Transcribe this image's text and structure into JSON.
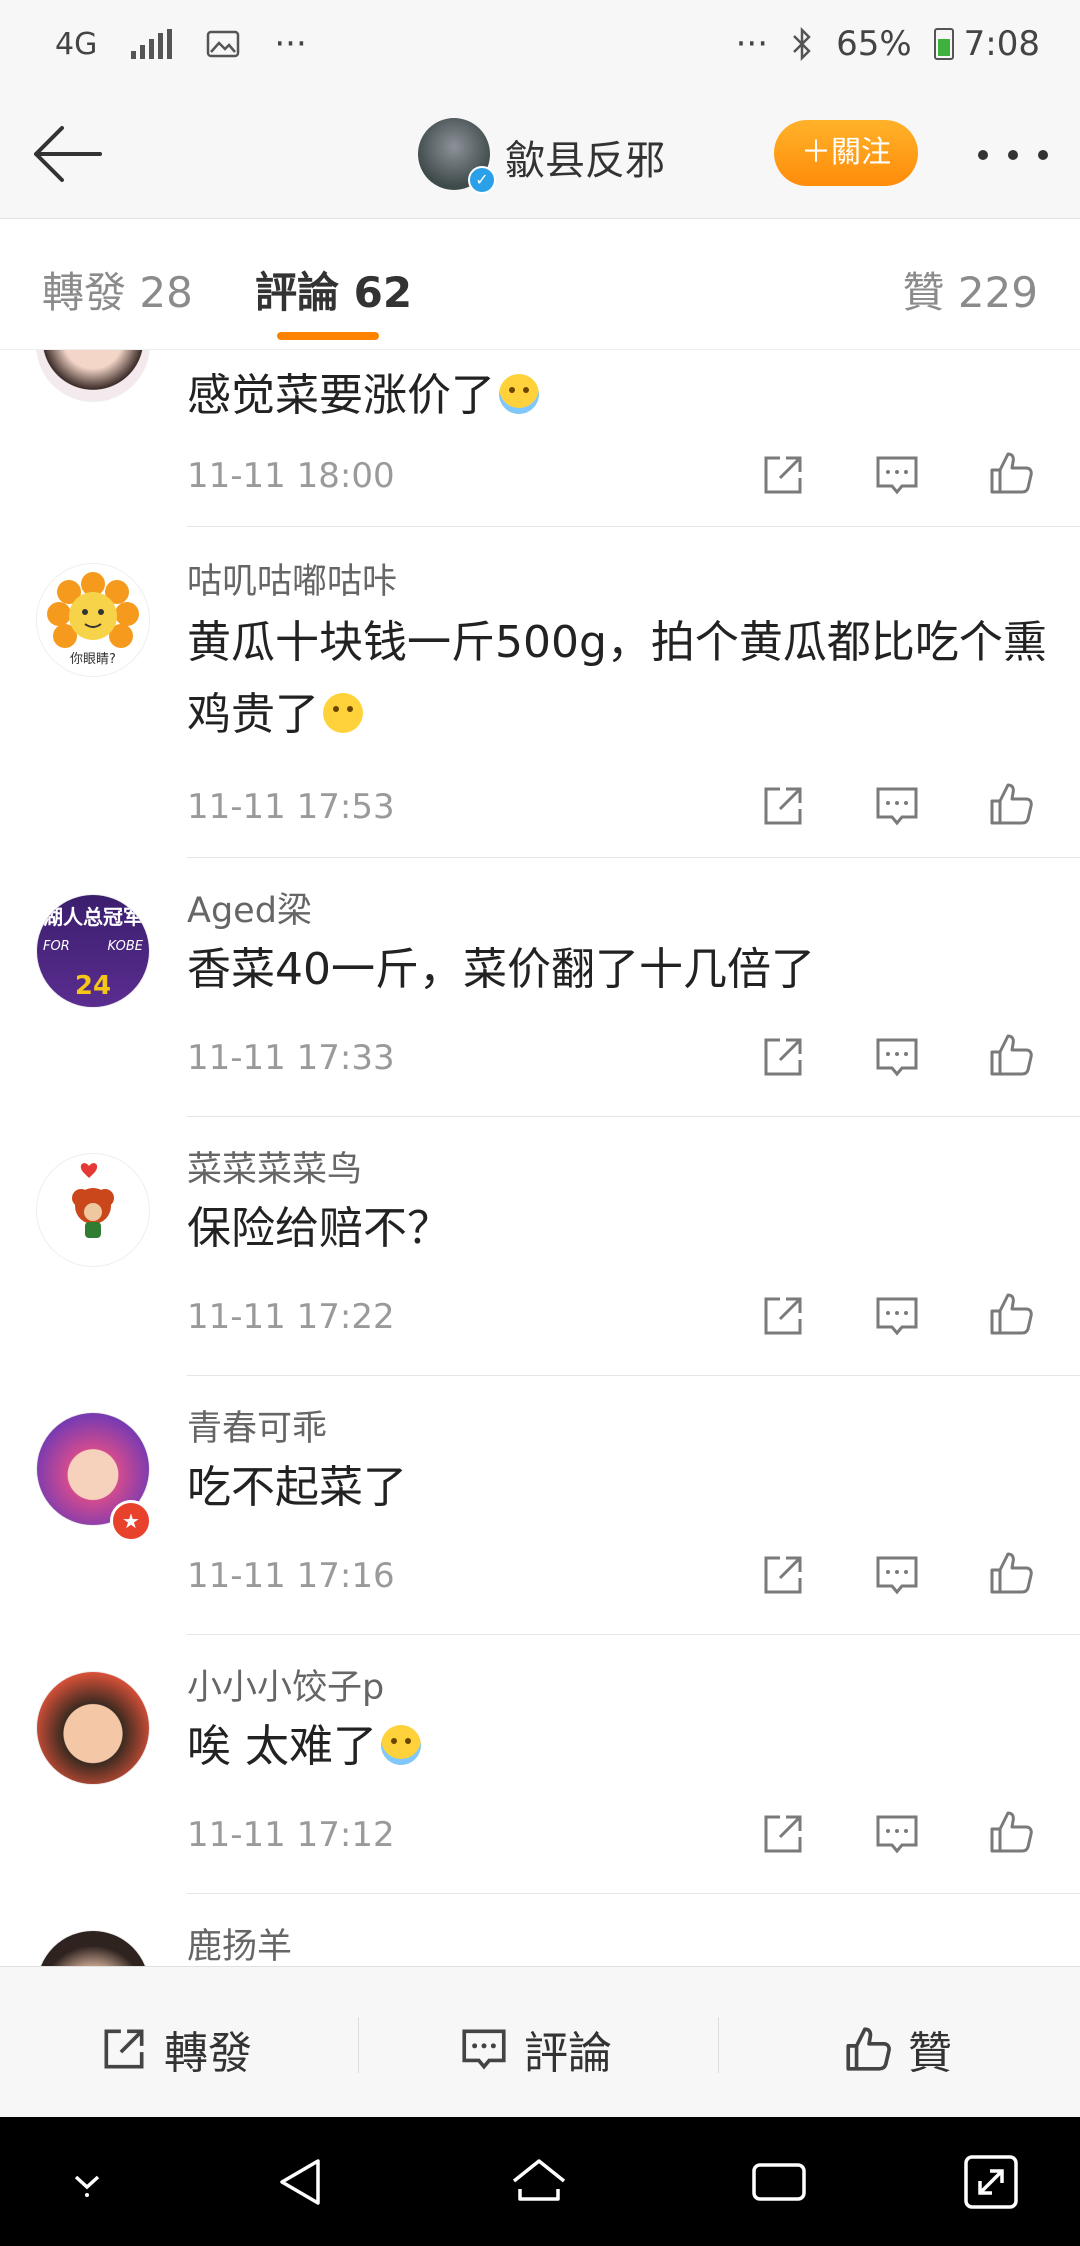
{
  "status_bar": {
    "network": "4G",
    "dots": "···",
    "right_dots": "···",
    "battery": "65%",
    "time": "7:08"
  },
  "header": {
    "title": "歙县反邪",
    "follow_label": "＋關注"
  },
  "tabs": {
    "repost": "轉發 28",
    "comments": "評論 62",
    "likes": "贊 229"
  },
  "comments": [
    {
      "user": "",
      "text": "感觉菜要涨价了",
      "emoji": "crying-laughing",
      "time": "11-11 18:00"
    },
    {
      "user": "咕叽咕嘟咕咔",
      "text": "黄瓜十块钱一斤500g，拍个黄瓜都比吃个熏鸡贵了",
      "emoji": "shrug",
      "time": "11-11 17:53"
    },
    {
      "user": "Aged梁",
      "text": "香菜40一斤，菜价翻了十几倍了",
      "time": "11-11 17:33"
    },
    {
      "user": "菜菜菜菜鸟",
      "text": "保险给赔不？",
      "time": "11-11 17:22"
    },
    {
      "user": "青春可乖",
      "text": "吃不起菜了",
      "time": "11-11 17:16"
    },
    {
      "user": "小小小饺子p",
      "text": "唉 太难了",
      "emoji": "crying",
      "time": "11-11 17:12"
    },
    {
      "user": "鹿扬羊"
    }
  ],
  "avatar_text": {
    "c2": "你眼睛?",
    "c3_top": "湖人总冠军",
    "c3_left": "FOR",
    "c3_right": "KOBE",
    "c3_num": "24"
  },
  "bottom_bar": {
    "repost": "轉發",
    "comment": "評論",
    "like": "贊"
  },
  "colors": {
    "accent": "#ff8200",
    "follow_button": "#ff9a10"
  }
}
